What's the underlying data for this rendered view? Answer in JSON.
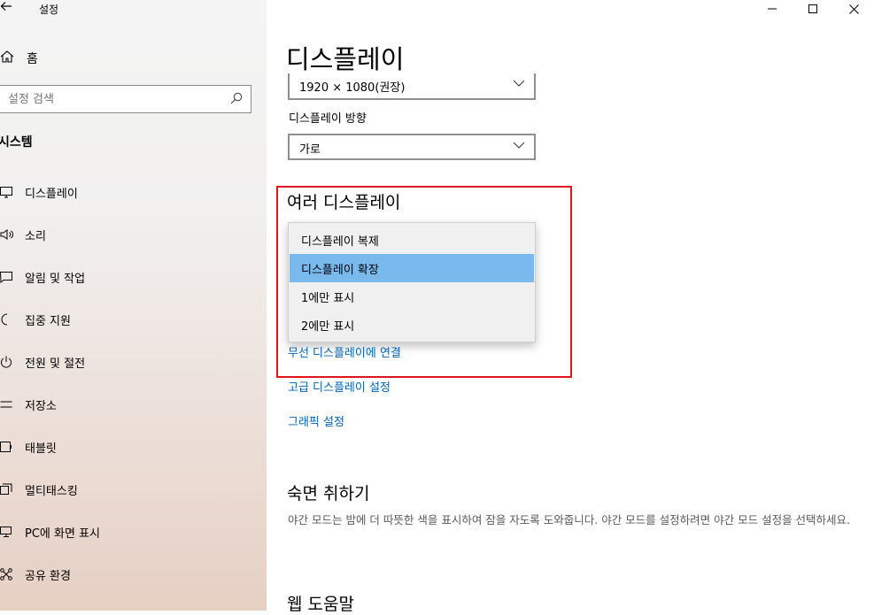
{
  "app": {
    "title": "설정"
  },
  "window": {
    "minimize": "—",
    "maximize": "☐",
    "close": "✕"
  },
  "sidebar": {
    "home": "홈",
    "search_placeholder": "설정 검색",
    "section": "시스템",
    "items": [
      {
        "label": "디스플레이",
        "icon": "monitor-icon"
      },
      {
        "label": "소리",
        "icon": "speaker-icon"
      },
      {
        "label": "알림 및 작업",
        "icon": "notification-icon"
      },
      {
        "label": "집중 지원",
        "icon": "moon-icon"
      },
      {
        "label": "전원 및 절전",
        "icon": "power-icon"
      },
      {
        "label": "저장소",
        "icon": "storage-icon"
      },
      {
        "label": "태블릿",
        "icon": "tablet-icon"
      },
      {
        "label": "멀티태스킹",
        "icon": "multitask-icon"
      },
      {
        "label": "PC에 화면 표시",
        "icon": "project-icon"
      },
      {
        "label": "공유 환경",
        "icon": "share-icon"
      }
    ]
  },
  "main": {
    "title": "디스플레이",
    "resolution_value": "1920 × 1080(권장)",
    "orientation_label": "디스플레이 방향",
    "orientation_value": "가로",
    "multi_display_heading": "여러 디스플레이",
    "dropdown_options": [
      "디스플레이 복제",
      "디스플레이 확장",
      "1에만 표시",
      "2에만 표시"
    ],
    "dropdown_selected": "디스플레이 확장",
    "links": [
      "무선 디스플레이에 연결",
      "고급 디스플레이 설정",
      "그래픽 설정"
    ],
    "sleep_heading": "숙면 취하기",
    "sleep_desc": "야간 모드는 밤에 더 따뜻한 색을 표시하여 잠을 자도록 도와줍니다. 야간 모드를 설정하려면 야간 모드 설정을 선택하세요.",
    "web_help_heading": "웹 도움말"
  },
  "colors": {
    "accent": "#0064b4",
    "highlight": "#79b9ee",
    "annotation": "#e0141e"
  }
}
